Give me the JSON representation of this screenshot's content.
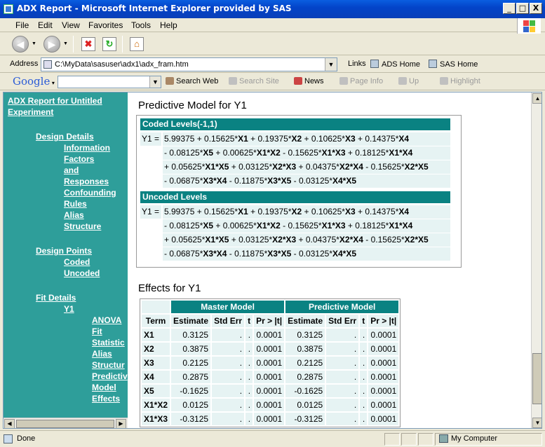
{
  "window": {
    "title": "ADX Report - Microsoft Internet Explorer provided by SAS",
    "min": "_",
    "max": "□",
    "close": "X"
  },
  "menu": {
    "items": [
      "File",
      "Edit",
      "View",
      "Favorites",
      "Tools",
      "Help"
    ]
  },
  "address": {
    "label": "Address",
    "value": "C:\\MyData\\sasuser\\adx1\\adx_fram.htm",
    "links_label": "Links",
    "links": [
      "ADS Home",
      "SAS Home"
    ]
  },
  "google": {
    "logo": "Google",
    "search_web": "Search Web",
    "search_site": "Search Site",
    "news": "News",
    "page_info": "Page Info",
    "up": "Up",
    "highlight": "Highlight"
  },
  "nav": {
    "report_title_line1": "ADX Report for Untitled",
    "report_title_line2": "Experiment",
    "design_details": "Design Details",
    "info": "Information",
    "factors": "Factors",
    "and": "and",
    "responses": "Responses",
    "confounding": "Confounding",
    "rules": "Rules",
    "alias": "Alias",
    "structure": "Structure",
    "design_points": "Design Points",
    "coded": "Coded",
    "uncoded": "Uncoded",
    "fit_details": "Fit Details",
    "y1": "Y1",
    "anova": "ANOVA",
    "fit": "Fit",
    "statistics": "Statistic",
    "alias2": "Alias",
    "structure2": "Structur",
    "predictive": "Predictiv",
    "model": "Model",
    "effects": "Effects"
  },
  "predictive_model": {
    "title": "Predictive Model for Y1",
    "coded_header": "Coded Levels(-1,1)",
    "uncoded_header": "Uncoded Levels",
    "lhs": "Y1 =",
    "line1": "5.99375 + 0.15625*X1 + 0.19375*X2 + 0.10625*X3 + 0.14375*X4",
    "line2": "- 0.08125*X5 + 0.00625*X1*X2 - 0.15625*X1*X3 + 0.18125*X1*X4",
    "line3": "+ 0.05625*X1*X5 + 0.03125*X2*X3 + 0.04375*X2*X4 - 0.15625*X2*X5",
    "line4": "- 0.06875*X3*X4 - 0.11875*X3*X5 - 0.03125*X4*X5"
  },
  "effects": {
    "title": "Effects for Y1",
    "band_master": "Master Model",
    "band_predictive": "Predictive Model",
    "columns": [
      "Term",
      "Estimate",
      "Std Err",
      "t",
      "Pr > |t|",
      "Estimate",
      "Std Err",
      "t",
      "Pr > |t|"
    ],
    "rows": [
      [
        "X1",
        "0.3125",
        ".",
        ".",
        "0.0001",
        "0.3125",
        ".",
        ".",
        "0.0001"
      ],
      [
        "X2",
        "0.3875",
        ".",
        ".",
        "0.0001",
        "0.3875",
        ".",
        ".",
        "0.0001"
      ],
      [
        "X3",
        "0.2125",
        ".",
        ".",
        "0.0001",
        "0.2125",
        ".",
        ".",
        "0.0001"
      ],
      [
        "X4",
        "0.2875",
        ".",
        ".",
        "0.0001",
        "0.2875",
        ".",
        ".",
        "0.0001"
      ],
      [
        "X5",
        "-0.1625",
        ".",
        ".",
        "0.0001",
        "-0.1625",
        ".",
        ".",
        "0.0001"
      ],
      [
        "X1*X2",
        "0.0125",
        ".",
        ".",
        "0.0001",
        "0.0125",
        ".",
        ".",
        "0.0001"
      ],
      [
        "X1*X3",
        "-0.3125",
        ".",
        ".",
        "0.0001",
        "-0.3125",
        ".",
        ".",
        "0.0001"
      ]
    ]
  },
  "status": {
    "text": "Done",
    "zone": "My Computer"
  },
  "colors": {
    "header_teal": "#0a8282",
    "nav_teal": "#2e9e9a",
    "cell_bg": "#e6f3f3"
  }
}
